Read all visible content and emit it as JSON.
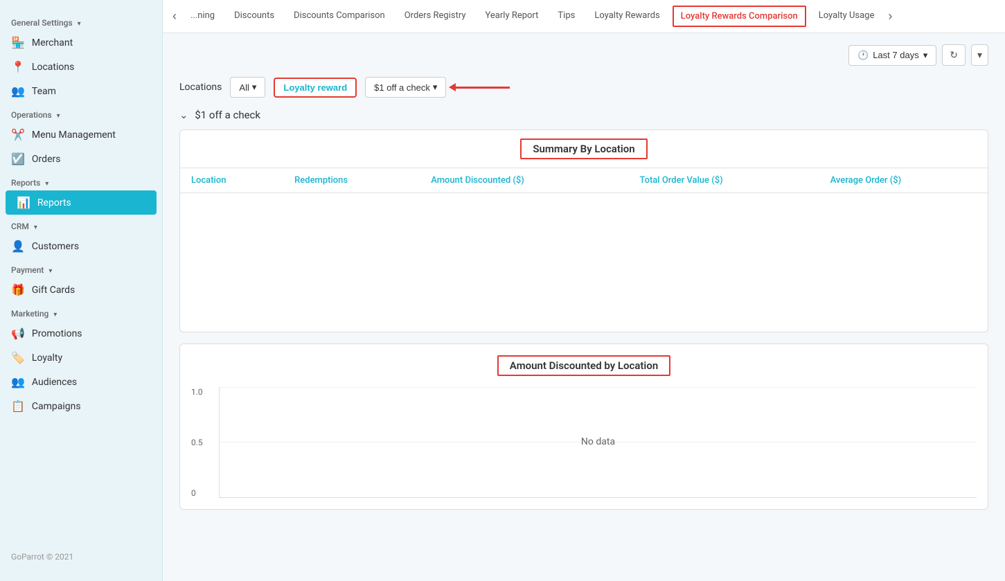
{
  "sidebar": {
    "general_settings_label": "General Settings",
    "operations_label": "Operations",
    "reports_label": "Reports",
    "crm_label": "CRM",
    "payment_label": "Payment",
    "marketing_label": "Marketing",
    "footer": "GoParrot © 2021",
    "items": {
      "merchant": "Merchant",
      "locations": "Locations",
      "team": "Team",
      "menu_management": "Menu Management",
      "orders": "Orders",
      "reports": "Reports",
      "customers": "Customers",
      "gift_cards": "Gift Cards",
      "promotions": "Promotions",
      "loyalty": "Loyalty",
      "audiences": "Audiences",
      "campaigns": "Campaigns"
    }
  },
  "tabs": [
    {
      "label": "...ning",
      "active": false
    },
    {
      "label": "Discounts",
      "active": false
    },
    {
      "label": "Discounts Comparison",
      "active": false
    },
    {
      "label": "Orders Registry",
      "active": false
    },
    {
      "label": "Yearly Report",
      "active": false
    },
    {
      "label": "Tips",
      "active": false
    },
    {
      "label": "Loyalty Rewards",
      "active": false
    },
    {
      "label": "Loyalty Rewards Comparison",
      "active": true
    },
    {
      "label": "Loyalty Usage",
      "active": false
    }
  ],
  "toolbar": {
    "date_range": "Last 7 days"
  },
  "filters": {
    "locations_label": "Locations",
    "locations_value": "All",
    "loyalty_reward_label": "Loyalty reward",
    "reward_value": "$1 off a check"
  },
  "section": {
    "heading": "$1 off a check"
  },
  "summary_table": {
    "title": "Summary By Location",
    "columns": [
      "Location",
      "Redemptions",
      "Amount Discounted ($)",
      "Total Order Value ($)",
      "Average Order ($)"
    ],
    "rows": []
  },
  "chart": {
    "title": "Amount Discounted by Location",
    "y_labels": [
      "1.0",
      "0.5",
      "0"
    ],
    "no_data": "No data"
  }
}
